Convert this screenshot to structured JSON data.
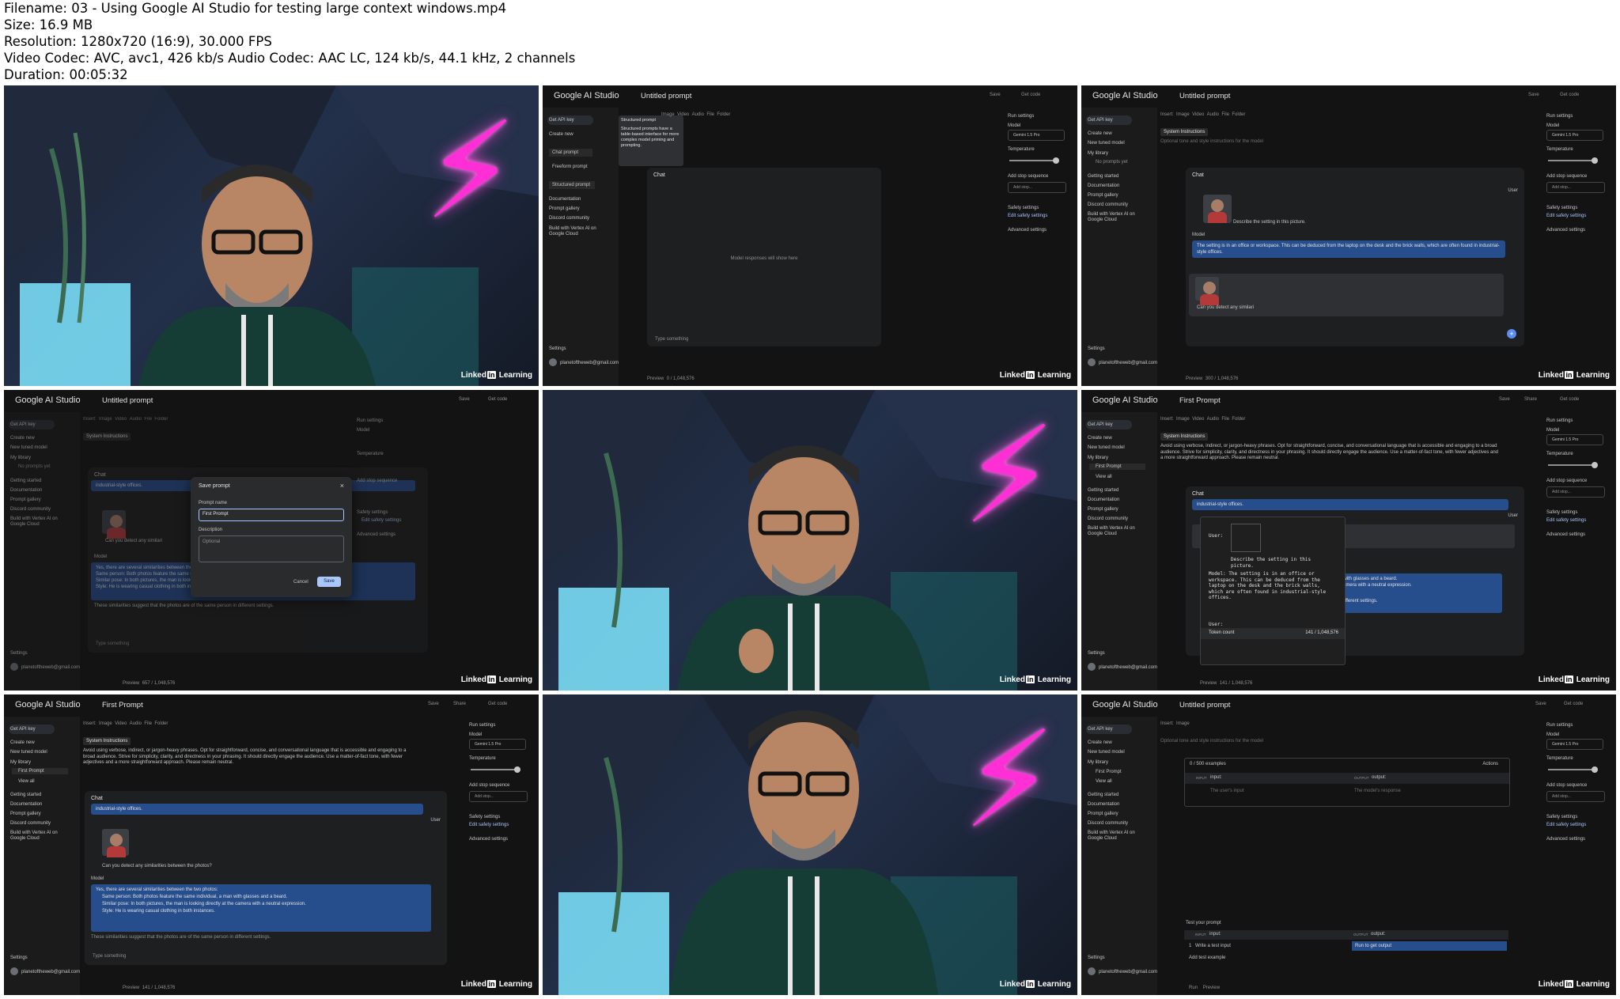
{
  "meta": {
    "filename": "Filename: 03 - Using Google AI Studio for testing large context windows.mp4",
    "size": "Size: 16.9 MB",
    "resolution": "Resolution: 1280x720 (16:9), 30.000 FPS",
    "codec": "Video Codec: AVC, avc1, 426 kb/s Audio Codec: AAC LC, 124 kb/s, 44.1 kHz, 2 channels",
    "duration": "Duration: 00:05:32"
  },
  "watermark": {
    "pre": "Linked",
    "mark": "in",
    "post": " Learning"
  },
  "app": {
    "brand": "Google AI Studio",
    "untitled": "Untitled prompt",
    "first": "First Prompt",
    "save": "Save",
    "share": "Share",
    "get_code": "Get code",
    "get_api_key": "Get API key",
    "create_new": "Create new",
    "new_tuned": "New tuned model",
    "my_library": "My library",
    "no_prompts": "No prompts yet",
    "first_prompt_item": "First Prompt",
    "view_all": "View all",
    "getting_started": "Getting started",
    "documentation": "Documentation",
    "prompt_gallery": "Prompt gallery",
    "discord": "Discord community",
    "vertex": "Build with Vertex AI on Google Cloud",
    "settings": "Settings",
    "email": "planetoftheweb@gmail.com",
    "insert": "Insert:",
    "image": "Image",
    "video": "Video",
    "audio": "Audio",
    "file": "File",
    "folder": "Folder",
    "system_instructions": "System Instructions",
    "sys_placeholder": "Optional tone and style instructions for the model",
    "sys_text": "Avoid using verbose, indirect, or jargon-heavy phrases. Opt for straightforward, concise, and conversational language that is accessible and engaging to a broad audience. Strive for simplicity, clarity, and directness in your phrasing. It should directly engage the audience. Use a matter-of-fact tone, with fewer adjectives and a more straightforward approach. Please remain neutral.",
    "chat": "Chat",
    "model_responses": "Model responses will show here",
    "type_something": "Type something",
    "run_settings": "Run settings",
    "reset": "Reset",
    "model": "Model",
    "gemini": "Gemini 1.5 Pro",
    "temperature": "Temperature",
    "add_stop_sequence": "Add stop sequence",
    "add_stop": "Add stop...",
    "safety_settings": "Safety settings",
    "edit_safety": "Edit safety settings",
    "advanced_settings": "Advanced settings",
    "preview": "Preview",
    "tok_0": "0 / 1,048,576",
    "tok_300": "300 / 1,048,576",
    "tok_657": "657 / 1,048,576",
    "tok_141": "141 / 1,048,576",
    "user": "User",
    "model_label": "Model",
    "describe": "Describe the setting in this picture.",
    "office_reply": "The setting is in an office or workspace. This can be deduced from the laptop on the desk and the brick walls, which are often found in industrial-style offices.",
    "industrial": "industrial-style offices.",
    "detect_partial": "Can you detect any similari",
    "detect_full": "Can you detect any similarities between the photos?",
    "yes_reply": "Yes, there are several similarities between the two photos:",
    "same_person": "Same person: Both photos feature the same individual, a man with glasses and a beard.",
    "similar_pose": "Similar pose: In both pictures, the man is looking directly at the camera with a neutral expression.",
    "style": "Style: He is wearing casual clothing in both instances.",
    "conclusion": "These similarities suggest that the photos are of the same person in different settings.",
    "chat_prompt": "Chat prompt",
    "freeform_prompt": "Freeform prompt",
    "structured_prompt": "Structured prompt",
    "tooltip_title": "Structured prompt",
    "tooltip_text": "Structured prompts have a table-based interface for more complex model priming and prompting.",
    "save_prompt": "Save prompt",
    "prompt_name": "Prompt name",
    "prompt_name_value": "First Prompt",
    "description": "Description",
    "optional": "Optional",
    "cancel": "Cancel",
    "token_count": "Token count",
    "code_user": "User:",
    "code_describe": "Describe the setting in this picture.",
    "code_model": "Model: The setting is in an office or workspace. This can be deduced from the laptop on the desk and the brick walls, which are often found in industrial-style offices.",
    "code_user2": "User:",
    "code_glasses": "man with glasses and a beard.",
    "code_camera": "the camera with a neutral expression.",
    "code_settings": "s in different settings.",
    "examples": "0 / 500 examples",
    "actions": "Actions",
    "input_col": "input:",
    "output_col": "output:",
    "input_tag": "INPUT",
    "output_tag": "OUTPUT",
    "users_input": "The user's input",
    "models_response": "The model's response",
    "test_prompt": "Test your prompt",
    "row_num": "1",
    "write_test": "Write a test input",
    "run_output": "Run to get output",
    "add_test": "Add test example",
    "run": "Run"
  }
}
